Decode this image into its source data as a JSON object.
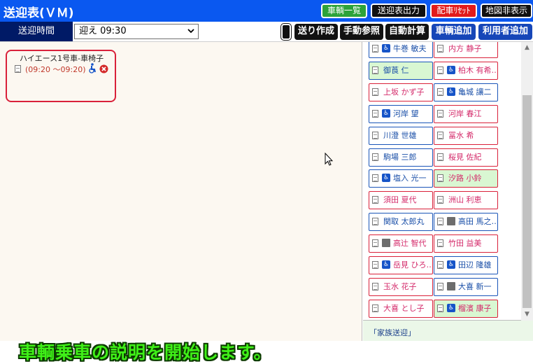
{
  "app": {
    "title": "送迎表(ＶＭ)"
  },
  "top_buttons": [
    {
      "label": "車輌一覧",
      "bg": "#2ca33a"
    },
    {
      "label": "送迎表出力",
      "bg": "#111111"
    },
    {
      "label": "配車ﾘｾｯﾄ",
      "bg": "#e21b1b"
    },
    {
      "label": "地図非表示",
      "bg": "#111111"
    }
  ],
  "toolbar": {
    "time_label": "送迎時間",
    "time_value": "迎え 09:30",
    "buttons": [
      {
        "label": "",
        "bg": "#111111"
      },
      {
        "label": "送り作成",
        "bg": "#111111"
      },
      {
        "label": "手動参照",
        "bg": "#111111"
      },
      {
        "label": "自動計算",
        "bg": "#111111"
      },
      {
        "label": "車輌追加",
        "bg": "#1646b8"
      },
      {
        "label": "利用者追加",
        "bg": "#1646b8"
      }
    ]
  },
  "vehicle": {
    "name": "ハイエース1号車-車椅子",
    "time": "(09:20 ～09:20)"
  },
  "caption": "車輌乗車の説明を開始します。",
  "users": [
    {
      "name": "牛巻 敏夫",
      "color": "blue",
      "wheelchair": true
    },
    {
      "name": "内方 静子",
      "color": "red"
    },
    {
      "name": "御莨 仁",
      "color": "blue",
      "bg": "green"
    },
    {
      "name": "柏木 有希…",
      "color": "red",
      "wheelchair": true
    },
    {
      "name": "上坂 かず子",
      "color": "red"
    },
    {
      "name": "亀城 讓二",
      "color": "blue",
      "wheelchair": true
    },
    {
      "name": "河岸 望",
      "color": "blue",
      "wheelchair": true
    },
    {
      "name": "河岸 春江",
      "color": "red"
    },
    {
      "name": "川澄 世雄",
      "color": "blue"
    },
    {
      "name": "冨水 希",
      "color": "red"
    },
    {
      "name": "駒場 三郎",
      "color": "blue"
    },
    {
      "name": "桜見 佐紀",
      "color": "red"
    },
    {
      "name": "塩入 光一",
      "color": "blue",
      "wheelchair": true
    },
    {
      "name": "汐路 小鈴",
      "color": "red",
      "bg": "green"
    },
    {
      "name": "須田 夏代",
      "color": "red"
    },
    {
      "name": "洲山 利恵",
      "color": "red"
    },
    {
      "name": "関取 太郎丸",
      "color": "blue"
    },
    {
      "name": "高田 馬之…",
      "color": "blue",
      "photo": true
    },
    {
      "name": "高辻 智代",
      "color": "red",
      "photo": true
    },
    {
      "name": "竹田 益美",
      "color": "red"
    },
    {
      "name": "岳見 ひろ…",
      "color": "red",
      "wheelchair": true
    },
    {
      "name": "田辺 隆雄",
      "color": "blue",
      "wheelchair": true
    },
    {
      "name": "玉水 花子",
      "color": "red"
    },
    {
      "name": "大喜 新一",
      "color": "blue",
      "photo": true
    },
    {
      "name": "大喜 とし子",
      "color": "red"
    },
    {
      "name": "榴濱 康子",
      "color": "red",
      "wheelchair": true,
      "bg": "green"
    }
  ],
  "footer": {
    "text": "「家族送迎」"
  }
}
